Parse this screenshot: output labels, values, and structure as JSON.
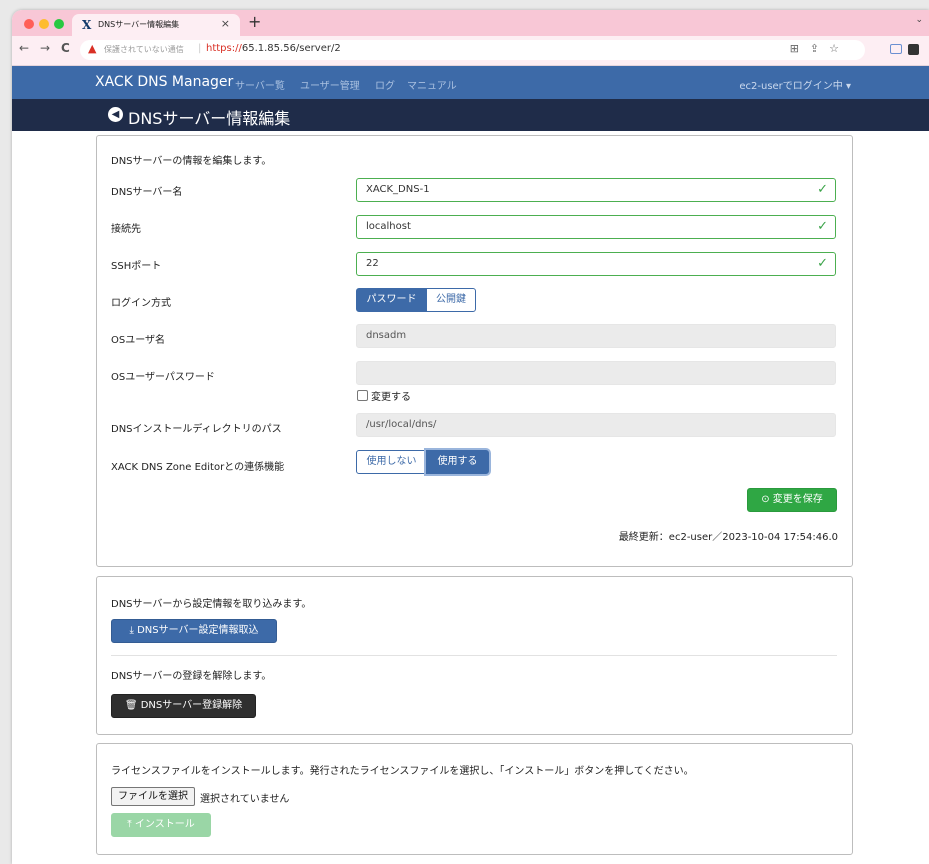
{
  "browser": {
    "tab_title": "DNSサーバー情報編集",
    "tab_favicon": "X",
    "close_tab": "×",
    "new_tab": "+",
    "tab_list": "⌄",
    "back": "←",
    "forward": "→",
    "reload": "C",
    "security_warning_icon": "▲",
    "insecure_label": "保護されていない通信",
    "url_scheme": "https://",
    "url_rest": "65.1.85.56/server/2",
    "bookmark": "☆",
    "share": "⇪",
    "translate": "⊞"
  },
  "navbar": {
    "brand": "XACK DNS Manager",
    "links": [
      "サーバー覧",
      "ユーザー管理",
      "ログ",
      "マニュアル"
    ],
    "user_menu": "ec2-userでログイン中 ▾"
  },
  "title": {
    "icon": "◀",
    "text": "DNSサーバー情報編集"
  },
  "edit_form": {
    "intro": "DNSサーバーの情報を編集します。",
    "server_name": {
      "label": "DNSサーバー名",
      "value": "XACK_DNS-1"
    },
    "host": {
      "label": "接続先",
      "value": "localhost"
    },
    "ssh_port": {
      "label": "SSHポート",
      "value": "22"
    },
    "login_method": {
      "label": "ログイン方式",
      "options": [
        "パスワード",
        "公開鍵"
      ],
      "selected": "パスワード"
    },
    "os_user": {
      "label": "OSユーザ名",
      "value": "dnsadm"
    },
    "os_password": {
      "label": "OSユーザーパスワード",
      "value": "",
      "change_label": "変更する",
      "change_checked": false
    },
    "install_path": {
      "label": "DNSインストールディレクトリのパス",
      "value": "/usr/local/dns/"
    },
    "zone_editor": {
      "label": "XACK DNS Zone Editorとの連係機能",
      "options": [
        "使用しない",
        "使用する"
      ],
      "selected": "使用する"
    },
    "save_button": "変更を保存",
    "save_icon": "⊙",
    "check_mark": "✓",
    "last_updated": "最終更新：ec2-user／2023-10-04 17:54:46.0"
  },
  "import_panel": {
    "intro": "DNSサーバーから設定情報を取り込みます。",
    "import_button": "DNSサーバー設定情報取込",
    "import_icon": "⤓",
    "unregister_intro": "DNSサーバーの登録を解除します。",
    "unregister_button": "DNSサーバー登録解除",
    "unregister_icon": "🗑"
  },
  "license_panel": {
    "intro": "ライセンスファイルをインストールします。発行されたライセンスファイルを選択し、「インストール」ボタンを押してください。",
    "file_button": "ファイルを選択",
    "file_status": "選択されていません",
    "install_button": "インストール",
    "install_icon": "⤒"
  },
  "colors": {
    "navbar": "#3d6aa8",
    "titlebar": "#1f2c49",
    "success": "#2fa744",
    "tab_strip": "#f8c7d6"
  }
}
